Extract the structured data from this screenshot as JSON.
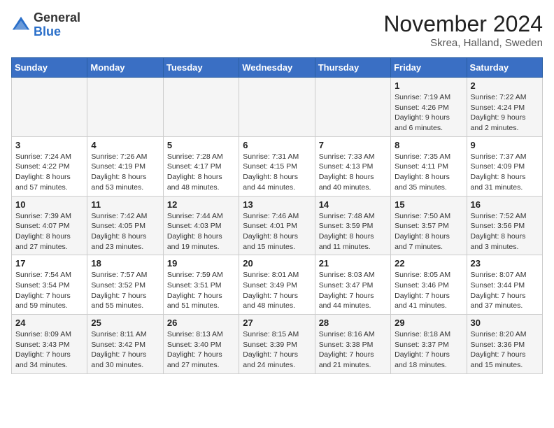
{
  "logo": {
    "general": "General",
    "blue": "Blue"
  },
  "title": "November 2024",
  "location": "Skrea, Halland, Sweden",
  "headers": [
    "Sunday",
    "Monday",
    "Tuesday",
    "Wednesday",
    "Thursday",
    "Friday",
    "Saturday"
  ],
  "weeks": [
    [
      {
        "day": "",
        "info": ""
      },
      {
        "day": "",
        "info": ""
      },
      {
        "day": "",
        "info": ""
      },
      {
        "day": "",
        "info": ""
      },
      {
        "day": "",
        "info": ""
      },
      {
        "day": "1",
        "info": "Sunrise: 7:19 AM\nSunset: 4:26 PM\nDaylight: 9 hours\nand 6 minutes."
      },
      {
        "day": "2",
        "info": "Sunrise: 7:22 AM\nSunset: 4:24 PM\nDaylight: 9 hours\nand 2 minutes."
      }
    ],
    [
      {
        "day": "3",
        "info": "Sunrise: 7:24 AM\nSunset: 4:22 PM\nDaylight: 8 hours\nand 57 minutes."
      },
      {
        "day": "4",
        "info": "Sunrise: 7:26 AM\nSunset: 4:19 PM\nDaylight: 8 hours\nand 53 minutes."
      },
      {
        "day": "5",
        "info": "Sunrise: 7:28 AM\nSunset: 4:17 PM\nDaylight: 8 hours\nand 48 minutes."
      },
      {
        "day": "6",
        "info": "Sunrise: 7:31 AM\nSunset: 4:15 PM\nDaylight: 8 hours\nand 44 minutes."
      },
      {
        "day": "7",
        "info": "Sunrise: 7:33 AM\nSunset: 4:13 PM\nDaylight: 8 hours\nand 40 minutes."
      },
      {
        "day": "8",
        "info": "Sunrise: 7:35 AM\nSunset: 4:11 PM\nDaylight: 8 hours\nand 35 minutes."
      },
      {
        "day": "9",
        "info": "Sunrise: 7:37 AM\nSunset: 4:09 PM\nDaylight: 8 hours\nand 31 minutes."
      }
    ],
    [
      {
        "day": "10",
        "info": "Sunrise: 7:39 AM\nSunset: 4:07 PM\nDaylight: 8 hours\nand 27 minutes."
      },
      {
        "day": "11",
        "info": "Sunrise: 7:42 AM\nSunset: 4:05 PM\nDaylight: 8 hours\nand 23 minutes."
      },
      {
        "day": "12",
        "info": "Sunrise: 7:44 AM\nSunset: 4:03 PM\nDaylight: 8 hours\nand 19 minutes."
      },
      {
        "day": "13",
        "info": "Sunrise: 7:46 AM\nSunset: 4:01 PM\nDaylight: 8 hours\nand 15 minutes."
      },
      {
        "day": "14",
        "info": "Sunrise: 7:48 AM\nSunset: 3:59 PM\nDaylight: 8 hours\nand 11 minutes."
      },
      {
        "day": "15",
        "info": "Sunrise: 7:50 AM\nSunset: 3:57 PM\nDaylight: 8 hours\nand 7 minutes."
      },
      {
        "day": "16",
        "info": "Sunrise: 7:52 AM\nSunset: 3:56 PM\nDaylight: 8 hours\nand 3 minutes."
      }
    ],
    [
      {
        "day": "17",
        "info": "Sunrise: 7:54 AM\nSunset: 3:54 PM\nDaylight: 7 hours\nand 59 minutes."
      },
      {
        "day": "18",
        "info": "Sunrise: 7:57 AM\nSunset: 3:52 PM\nDaylight: 7 hours\nand 55 minutes."
      },
      {
        "day": "19",
        "info": "Sunrise: 7:59 AM\nSunset: 3:51 PM\nDaylight: 7 hours\nand 51 minutes."
      },
      {
        "day": "20",
        "info": "Sunrise: 8:01 AM\nSunset: 3:49 PM\nDaylight: 7 hours\nand 48 minutes."
      },
      {
        "day": "21",
        "info": "Sunrise: 8:03 AM\nSunset: 3:47 PM\nDaylight: 7 hours\nand 44 minutes."
      },
      {
        "day": "22",
        "info": "Sunrise: 8:05 AM\nSunset: 3:46 PM\nDaylight: 7 hours\nand 41 minutes."
      },
      {
        "day": "23",
        "info": "Sunrise: 8:07 AM\nSunset: 3:44 PM\nDaylight: 7 hours\nand 37 minutes."
      }
    ],
    [
      {
        "day": "24",
        "info": "Sunrise: 8:09 AM\nSunset: 3:43 PM\nDaylight: 7 hours\nand 34 minutes."
      },
      {
        "day": "25",
        "info": "Sunrise: 8:11 AM\nSunset: 3:42 PM\nDaylight: 7 hours\nand 30 minutes."
      },
      {
        "day": "26",
        "info": "Sunrise: 8:13 AM\nSunset: 3:40 PM\nDaylight: 7 hours\nand 27 minutes."
      },
      {
        "day": "27",
        "info": "Sunrise: 8:15 AM\nSunset: 3:39 PM\nDaylight: 7 hours\nand 24 minutes."
      },
      {
        "day": "28",
        "info": "Sunrise: 8:16 AM\nSunset: 3:38 PM\nDaylight: 7 hours\nand 21 minutes."
      },
      {
        "day": "29",
        "info": "Sunrise: 8:18 AM\nSunset: 3:37 PM\nDaylight: 7 hours\nand 18 minutes."
      },
      {
        "day": "30",
        "info": "Sunrise: 8:20 AM\nSunset: 3:36 PM\nDaylight: 7 hours\nand 15 minutes."
      }
    ]
  ]
}
